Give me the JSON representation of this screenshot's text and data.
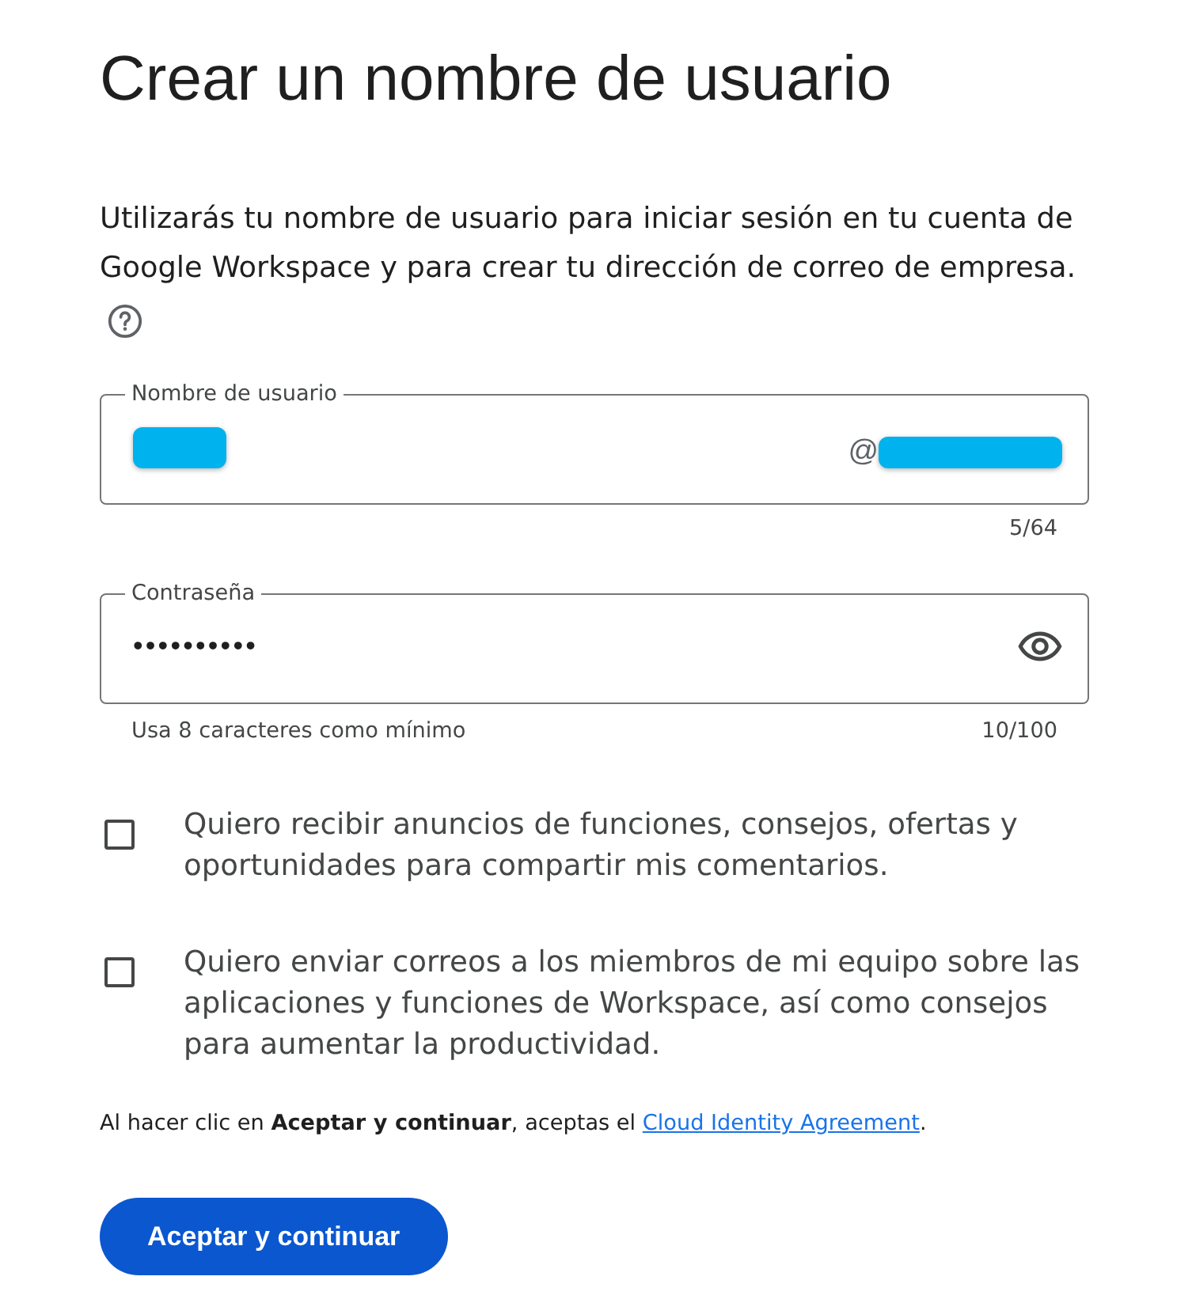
{
  "title": "Crear un nombre de usuario",
  "intro": {
    "text": "Utilizarás tu nombre de usuario para iniciar sesión en tu cuenta de Google Workspace y para crear tu dirección de correo de empresa."
  },
  "fields": [
    {
      "kind": "username",
      "label": "Nombre de usuario",
      "value_redacted": true,
      "suffix": "@",
      "suffix_redacted": true,
      "counter": "5/64"
    },
    {
      "kind": "password",
      "label": "Contraseña",
      "value": "••••••••••",
      "helper": "Usa 8 caracteres como mínimo",
      "counter": "10/100"
    }
  ],
  "checkboxes": [
    {
      "label": "Quiero recibir anuncios de funciones, consejos, ofertas y oportunidades para compartir mis comentarios.",
      "checked": false
    },
    {
      "label": "Quiero enviar correos a los miembros de mi equipo sobre las aplicaciones y funciones de Workspace, así como consejos para aumentar la productividad.",
      "checked": false
    }
  ],
  "consent": {
    "before": "Al hacer clic en **Aceptar y continuar**, aceptas el ",
    "link": "Cloud Identity Agreement",
    "after": "."
  },
  "button": {
    "label": "Aceptar y continuar"
  }
}
